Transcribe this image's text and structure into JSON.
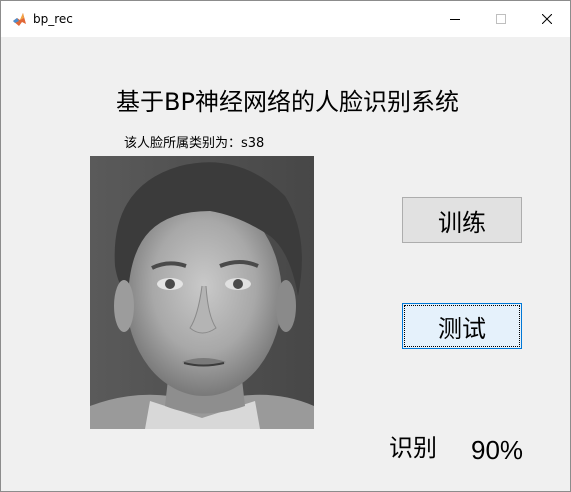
{
  "window": {
    "title": "bp_rec",
    "app_icon": "matlab-icon"
  },
  "main": {
    "heading": "基于BP神经网络的人脸识别系统",
    "result_label": "该人脸所属类别为：s38",
    "face_image": "face-photo",
    "train_button": "训练",
    "test_button": "测试",
    "recognition_label": "识别",
    "recognition_rate": "90%"
  },
  "colors": {
    "window_bg": "#f0f0f0",
    "titlebar_bg": "#ffffff",
    "train_button_bg": "#e1e1e1",
    "test_button_bg": "#e5f1fb",
    "test_button_border": "#0078d7"
  }
}
